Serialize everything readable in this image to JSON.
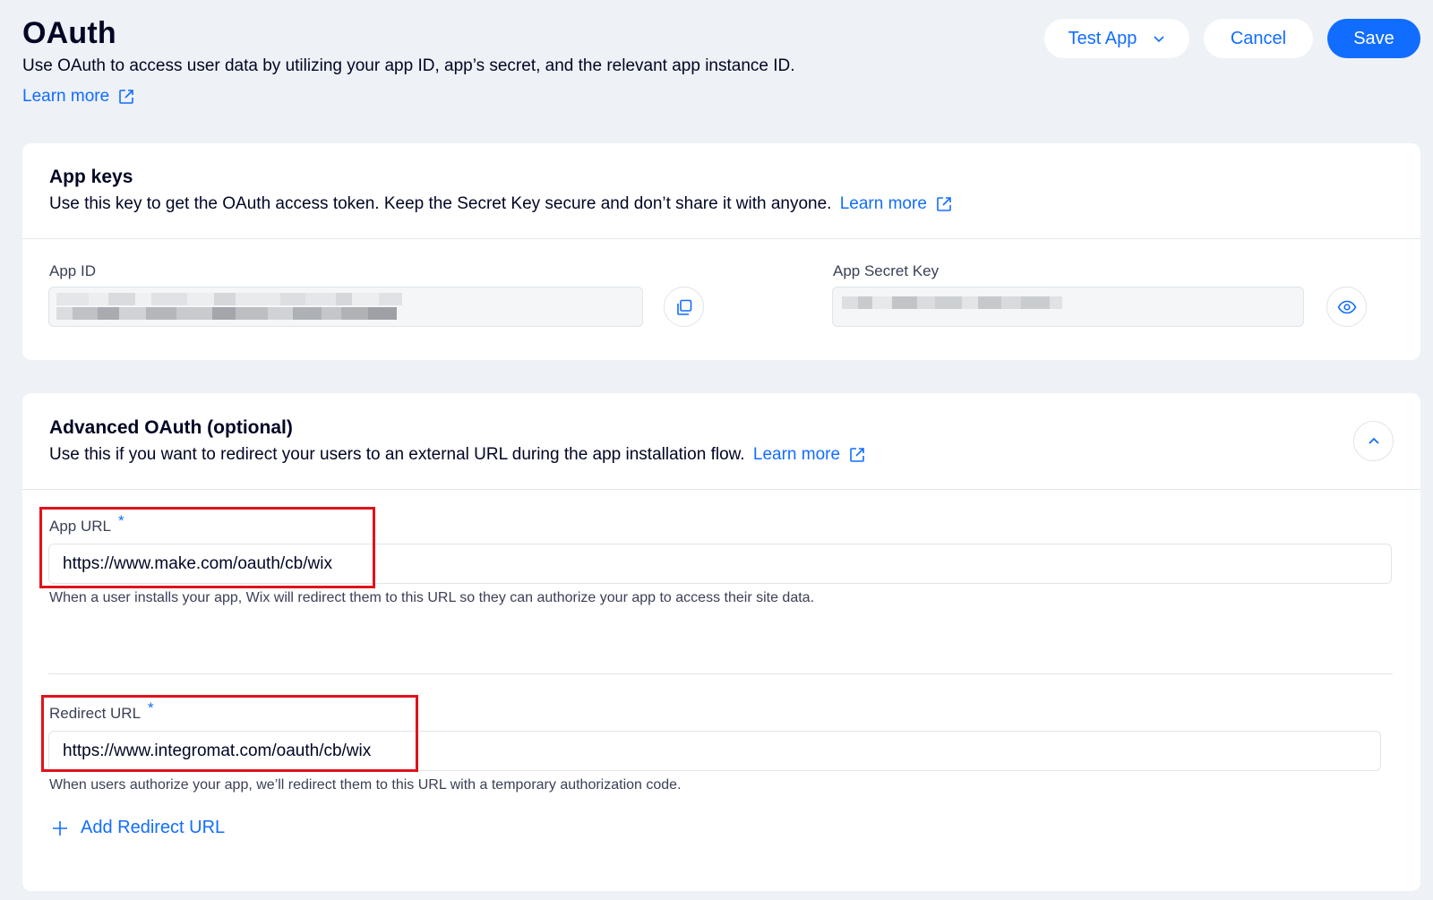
{
  "header": {
    "title": "OAuth",
    "subtitle": "Use OAuth to access user data by utilizing your app ID, app’s secret, and the relevant app instance ID.",
    "learn_more": "Learn more"
  },
  "actions": {
    "test_app": "Test App",
    "cancel": "Cancel",
    "save": "Save"
  },
  "app_keys": {
    "title": "App keys",
    "description": "Use this key to get the OAuth access token. Keep the Secret Key secure and don’t share it with anyone.",
    "learn_more": "Learn more",
    "app_id_label": "App ID",
    "app_secret_label": "App Secret Key"
  },
  "advanced": {
    "title": "Advanced OAuth (optional)",
    "description": "Use this if you want to redirect your users to an external URL during the app installation flow.",
    "learn_more": "Learn more",
    "app_url_label": "App URL",
    "app_url_value": "https://www.make.com/oauth/cb/wix",
    "app_url_help": "When a user installs your app, Wix will redirect them to this URL so they can authorize your app to access their site data.",
    "redirect_url_label": "Redirect URL",
    "redirect_url_value": "https://www.integromat.com/oauth/cb/wix",
    "redirect_url_help": "When users authorize your app, we’ll redirect them to this URL with a temporary authorization code.",
    "required_mark": "*",
    "add_redirect": "Add Redirect URL"
  },
  "colors": {
    "accent": "#116dff",
    "highlight": "#e0121b",
    "background": "#eef1f5"
  }
}
